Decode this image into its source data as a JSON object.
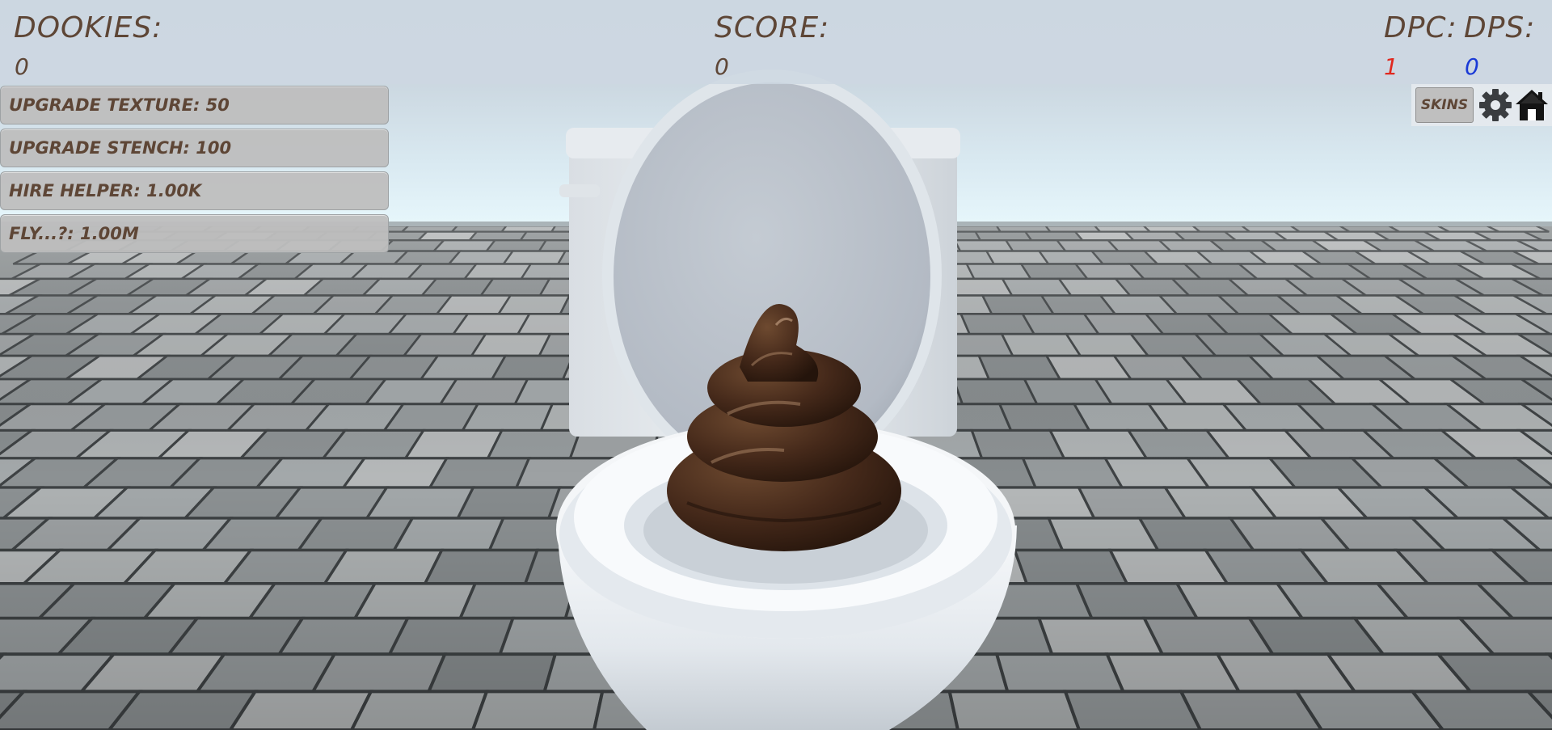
{
  "hud": {
    "dookies": {
      "label": "DOOKIES:",
      "value": "0"
    },
    "score": {
      "label": "SCORE:",
      "value": "0"
    },
    "dpc": {
      "label": "DPC:",
      "value": "1",
      "color": "#e0281e"
    },
    "dps": {
      "label": "DPS:",
      "value": "0",
      "color": "#1a3ad6"
    }
  },
  "upgrades": [
    {
      "label": "UPGRADE TEXTURE: 50"
    },
    {
      "label": "UPGRADE STENCH: 100"
    },
    {
      "label": "HIRE HELPER: 1.00K"
    },
    {
      "label": "FLY...?: 1.00M"
    }
  ],
  "menu": {
    "skins_label": "SKINS",
    "settings_icon": "gear-icon",
    "home_icon": "home-icon"
  },
  "colors": {
    "hud_text": "#5e4636",
    "sky": "#cbd7e0",
    "floor_tile": "#9fa4a6",
    "grout": "#3e4244",
    "porcelain": "#f0f3f5",
    "poop": "#4a2d1b"
  }
}
